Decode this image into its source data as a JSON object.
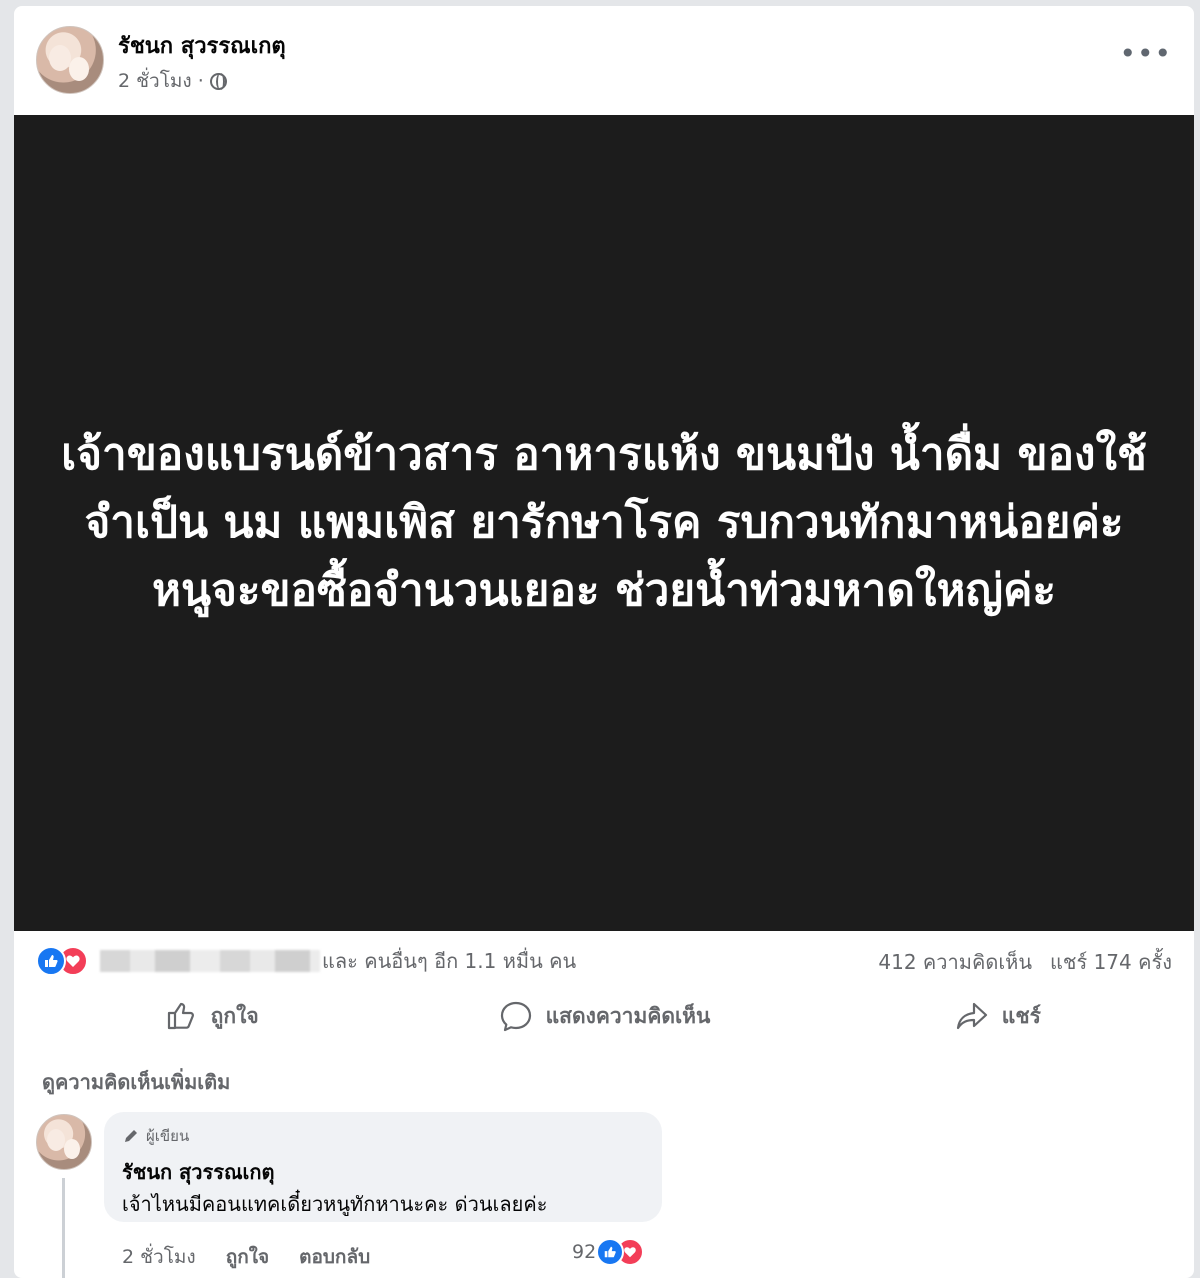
{
  "post": {
    "author": "รัชนก สุวรรณเกตุ",
    "time": "2 ชั่วโมง",
    "separator": "·",
    "more": "•••",
    "image_text": "เจ้าของแบรนด์ข้าวสาร อาหารแห้ง ขนมปัง น้ำดื่ม ของใช้จำเป็น นม แพมเพิส ยารักษาโรค รบกวนทักมาหน่อยค่ะ หนูจะขอซื้อจำนวนเยอะ ช่วยน้ำท่วมหาดใหญ่ค่ะ"
  },
  "reactions": {
    "like_icon": "thumbs-up",
    "love_icon": "heart",
    "others": "และ คนอื่นๆ อีก 1.1 หมื่น คน",
    "comments": "412 ความคิดเห็น",
    "shares": "แชร์ 174 ครั้ง"
  },
  "actions": {
    "like": "ถูกใจ",
    "comment": "แสดงความคิดเห็น",
    "share": "แชร์"
  },
  "comments_section": {
    "more_comments": "ดูความคิดเห็นเพิ่มเติม",
    "comment": {
      "badge": "ผู้เขียน",
      "author": "รัชนก สุวรรณเกตุ",
      "text": "เจ้าไหนมีคอนแทคเดี๋ยวหนูทักหานะคะ ด่วนเลยค่ะ",
      "time": "2 ชั่วโมง",
      "like": "ถูกใจ",
      "reply": "ตอบกลับ",
      "reaction_count": "92"
    }
  },
  "colors": {
    "like_blue": "#1877f2",
    "love_red": "#f33e58",
    "image_bg": "#1c1c1c"
  }
}
